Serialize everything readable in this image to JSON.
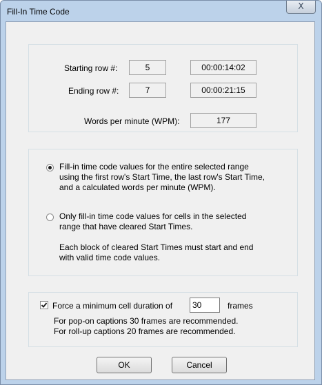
{
  "window": {
    "title": "Fill-In Time Code",
    "close_symbol": "X"
  },
  "rows": {
    "starting_label": "Starting row #:",
    "starting_row": "5",
    "starting_time": "00:00:14:02",
    "ending_label": "Ending row #:",
    "ending_row": "7",
    "ending_time": "00:00:21:15",
    "wpm_label": "Words per minute (WPM):",
    "wpm_value": "177"
  },
  "options": {
    "option1": {
      "selected": true,
      "lines": [
        "Fill-in time code values for the entire selected range",
        "using the first row's Start Time, the last row's Start Time,",
        "and a calculated words per minute (WPM)."
      ]
    },
    "option2": {
      "selected": false,
      "lines": [
        "Only fill-in time code values for cells in the selected",
        "range that have cleared Start Times."
      ],
      "note_lines": [
        "Each block of cleared Start Times must start and end",
        "with valid time code values."
      ]
    }
  },
  "force": {
    "checked": true,
    "label": "Force a minimum cell duration of",
    "value": "30",
    "unit": "frames",
    "note_lines": [
      "For pop-on captions 30 frames are recommended.",
      "For roll-up captions 20 frames are recommended."
    ]
  },
  "buttons": {
    "ok": "OK",
    "cancel": "Cancel"
  }
}
